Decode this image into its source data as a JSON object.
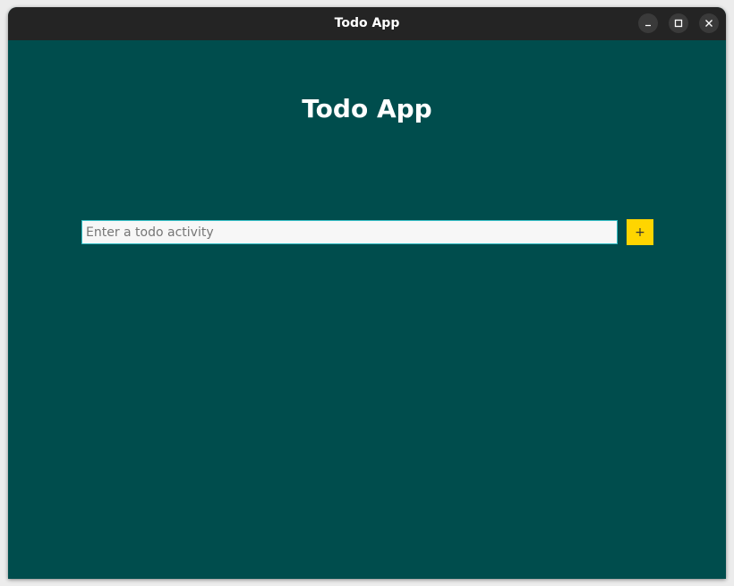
{
  "window": {
    "title": "Todo App",
    "controls": [
      "minimize-icon",
      "maximize-icon",
      "close-icon"
    ]
  },
  "app": {
    "heading": "Todo App",
    "input": {
      "placeholder": "Enter a todo activity",
      "value": ""
    },
    "add_button_label": "+"
  },
  "colors": {
    "background": "#004d4d",
    "titlebar": "#242424",
    "accent_button": "#ffd500",
    "input_border": "#38c0c8"
  }
}
